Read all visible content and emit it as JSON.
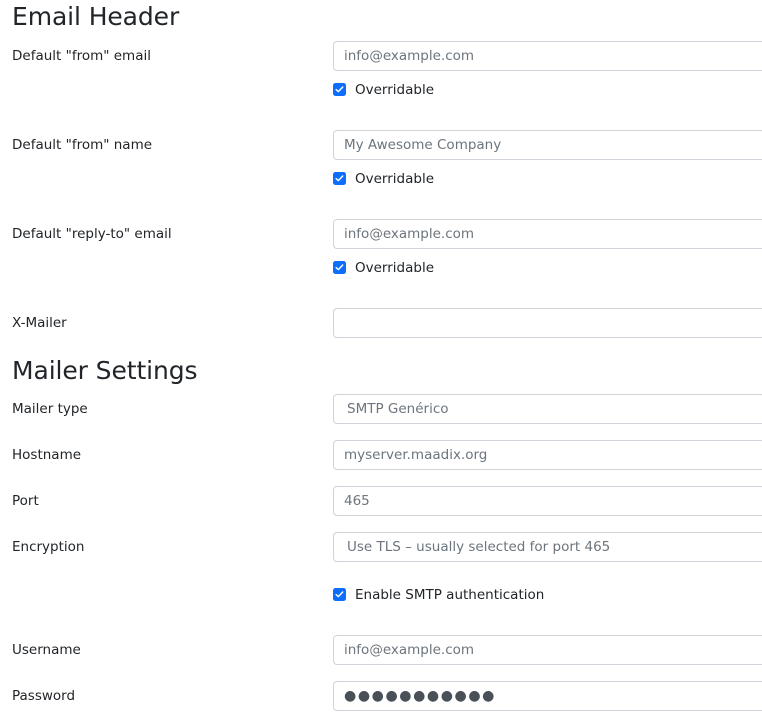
{
  "sections": [
    {
      "id": "email_header",
      "title": "Email Header"
    },
    {
      "id": "mailer_settings",
      "title": "Mailer Settings"
    }
  ],
  "email_header": {
    "title": "Email Header",
    "fields": [
      {
        "label": "Default \"from\" email",
        "type": "text",
        "placeholder": "info@example.com",
        "value": "info@example.com"
      },
      {
        "label": "Default \"from\" name",
        "type": "text",
        "placeholder": "My Awesome Company",
        "value": "My Awesome Company"
      },
      {
        "label": "Default \"reply-to\" email",
        "type": "text",
        "placeholder": "info@example.com",
        "value": "info@example.com"
      },
      {
        "label": "X-Mailer",
        "type": "text",
        "placeholder": "",
        "value": ""
      }
    ],
    "checkboxes": [
      {
        "label": "Overridable",
        "checked": true
      },
      {
        "label": "Overridable",
        "checked": true
      },
      {
        "label": "Overridable",
        "checked": true
      }
    ]
  },
  "mailer_settings": {
    "title": "Mailer Settings",
    "fields": [
      {
        "label": "Mailer type",
        "type": "select",
        "value": "SMTP Genérico"
      },
      {
        "label": "Hostname",
        "type": "text",
        "placeholder": "myserver.maadix.org",
        "value": "myserver.maadix.org"
      },
      {
        "label": "Port",
        "type": "text",
        "placeholder": "465",
        "value": "465"
      },
      {
        "label": "Encryption",
        "type": "select",
        "value": "Use TLS – usually selected for port 465"
      },
      {
        "label": "Username",
        "type": "text",
        "placeholder": "info@example.com",
        "value": "info@example.com"
      },
      {
        "label": "Password",
        "type": "password",
        "value": "●●●●●●●●●●●"
      }
    ],
    "checkboxes": [
      {
        "label": "Enable SMTP authentication",
        "checked": true
      }
    ]
  },
  "colors": {
    "accent": "#0d6efd",
    "border": "#ced4da",
    "label_text": "#212529",
    "placeholder_text": "#6c757d",
    "password_dots": "#495057",
    "background": "#ffffff"
  }
}
